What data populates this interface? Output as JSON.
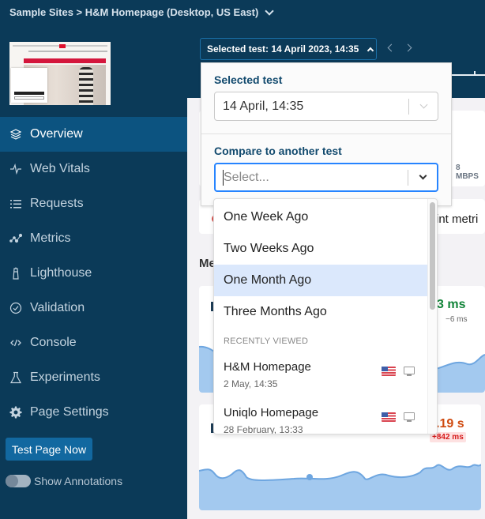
{
  "breadcrumb": {
    "text": "Sample Sites > H&M Homepage (Desktop, US East)"
  },
  "sidebar": {
    "items": [
      {
        "label": "Overview",
        "icon": "layers-icon",
        "active": true
      },
      {
        "label": "Web Vitals",
        "icon": "pulse-icon",
        "active": false
      },
      {
        "label": "Requests",
        "icon": "list-icon",
        "active": false
      },
      {
        "label": "Metrics",
        "icon": "chart-dots-icon",
        "active": false
      },
      {
        "label": "Lighthouse",
        "icon": "lighthouse-icon",
        "active": false
      },
      {
        "label": "Validation",
        "icon": "check-circle-icon",
        "active": false
      },
      {
        "label": "Console",
        "icon": "code-icon",
        "active": false
      },
      {
        "label": "Experiments",
        "icon": "flask-icon",
        "active": false
      },
      {
        "label": "Page Settings",
        "icon": "gear-icon",
        "active": false
      }
    ],
    "test_button": "Test Page Now",
    "annotations_label": "Show Annotations",
    "annotations_on": false
  },
  "test_selector": {
    "button_label": "Selected test: 14 April 2023, 14:35",
    "selected_label": "Selected test",
    "selected_value": "14 April, 14:35",
    "compare_label": "Compare to another test",
    "compare_placeholder": "Select...",
    "options": [
      "One Week Ago",
      "Two Weeks Ago",
      "One Month Ago",
      "Three Months Ago"
    ],
    "highlighted_option": "One Month Ago",
    "group_label": "RECENTLY VIEWED",
    "recent": [
      {
        "name": "H&M Homepage",
        "date": "2 May, 14:35",
        "region": "us-flag-icon",
        "device": "desktop-icon"
      },
      {
        "name": "Uniqlo Homepage",
        "date": "28 February, 13:33",
        "region": "us-flag-icon",
        "device": "desktop-icon"
      }
    ]
  },
  "background": {
    "bandwidth": "8 MBPS",
    "alert_text": "int metri",
    "section_title": "Me",
    "metric1": {
      "value": "3 ms",
      "delta": "−6 ms",
      "color": "#13853a"
    },
    "metric2": {
      "value": ".19 s",
      "delta": "+842 ms",
      "color": "#cf4a0f"
    }
  },
  "colors": {
    "sidebar_bg": "#0b3a58",
    "active_item": "#0c5380",
    "accent": "#2684ff",
    "button": "#1268a0",
    "highlight": "#dbe8fc"
  }
}
